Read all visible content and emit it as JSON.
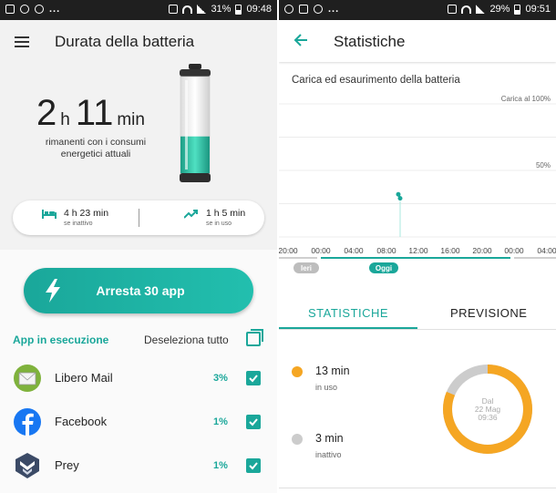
{
  "left": {
    "status": {
      "battery": "31%",
      "time": "09:48",
      "dots": "..."
    },
    "header": {
      "title": "Durata della batteria"
    },
    "remaining": {
      "hours": "2",
      "hours_unit": "h",
      "minutes": "11",
      "minutes_unit": "min",
      "caption_line1": "rimanenti con i consumi",
      "caption_line2": "energetici attuali"
    },
    "inactive": {
      "value": "4 h 23 min",
      "label": "se inattivo"
    },
    "in_use": {
      "value": "1 h 5 min",
      "label": "se in uso"
    },
    "stop_button": {
      "label": "Arresta 30 app"
    },
    "apps_header": {
      "title": "App in esecuzione",
      "deselect_all": "Deseleziona tutto"
    },
    "apps": [
      {
        "name": "Libero Mail",
        "percent": "3%",
        "checked": true
      },
      {
        "name": "Facebook",
        "percent": "1%",
        "checked": true
      },
      {
        "name": "Prey",
        "percent": "1%",
        "checked": true
      }
    ],
    "colors": {
      "accent": "#1aa79a",
      "battery_fill": "#2bc4a6"
    },
    "battery_fill_fraction": 0.38
  },
  "right": {
    "status": {
      "battery": "29%",
      "time": "09:51",
      "dots": "..."
    },
    "header": {
      "title": "Statistiche"
    },
    "chart_data": {
      "type": "line",
      "title": "Carica ed esaurimento della batteria",
      "y_labels": [
        "Carica al 100%",
        "50%"
      ],
      "x": [
        "20:00",
        "00:00",
        "04:00",
        "08:00",
        "12:00",
        "16:00",
        "20:00",
        "00:00",
        "04:00"
      ],
      "day_labels": [
        "Ieri",
        "Oggi"
      ],
      "series": [
        {
          "values": [
            32,
            29
          ]
        }
      ],
      "ylim": [
        0,
        100
      ],
      "grid": true
    },
    "tabs": {
      "statistics": "STATISTICHE",
      "forecast": "PREVISIONE"
    },
    "usage": {
      "value": "13 min",
      "label": "in uso",
      "color": "#f5a623"
    },
    "idle": {
      "value": "3 min",
      "label": "inattivo",
      "color": "#cccccc"
    },
    "donut": {
      "line1": "Dal",
      "line2": "22 Mag",
      "line3": "09:36",
      "in_use_minutes": 13,
      "idle_minutes": 3
    }
  }
}
